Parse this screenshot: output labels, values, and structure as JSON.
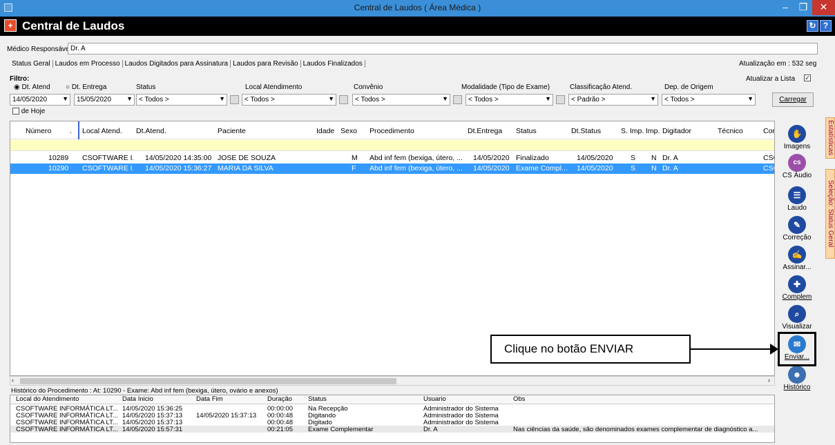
{
  "window": {
    "title": "Central de Laudos ( Área Médica )",
    "min": "–",
    "max": "❐",
    "close": "✕"
  },
  "app": {
    "title": "Central de Laudos",
    "logo": "+",
    "help": "?",
    "refresh": "↻"
  },
  "medico": {
    "label": "Médico Responsável:",
    "value": "Dr. A"
  },
  "tabs": [
    "Status Geral",
    "Laudos em Processo",
    "Laudos Digitados para Assinatura",
    "Laudos para Revisão",
    "Laudos Finalizados"
  ],
  "update_info": "Atualização em : 532 seg",
  "auto_update": {
    "label": "Atualizar a Lista",
    "checked": true
  },
  "filter": {
    "title": "Filtro:",
    "dt_atend": "Dt. Atend",
    "dt_entrega": "Dt. Entrega",
    "date_from": "14/05/2020",
    "date_to": "15/05/2020",
    "de_hoje": "de Hoje",
    "status_label": "Status",
    "status_value": "< Todos >",
    "local_label": "Local Atendimento",
    "local_value": "< Todos >",
    "convenio_label": "Convênio",
    "convenio_value": "< Todos >",
    "modalidade_label": "Modalidade (Tipo de Exame)",
    "modalidade_value": "< Todos >",
    "classif_label": "Classificação Atend.",
    "classif_value": "< Padrão >",
    "dep_label": "Dep. de Origem",
    "dep_value": "< Todos >",
    "carregar": "Carregar"
  },
  "grid": {
    "headers": [
      "Número",
      ".",
      "Local Atend.",
      "Dt.Atend.",
      "Paciente",
      "Idade",
      "Sexo",
      "Procedimento",
      "Dt.Entrega",
      "Status",
      "Dt.Status",
      "S. Imp.",
      "Imp.",
      "Digitador",
      "Técnico",
      "Cor"
    ],
    "rows": [
      [
        "10289",
        "CSOFTWARE I...",
        "14/05/2020 14:35:00",
        "JOSE DE SOUZA",
        "M",
        "Abd inf fem (bexiga, útero, ...",
        "14/05/2020",
        "Finalizado",
        "14/05/2020",
        "S",
        "N",
        "Dr. A",
        "CSC"
      ],
      [
        "10290",
        "CSOFTWARE I...",
        "14/05/2020 15:36:27",
        "MARIA DA SILVA",
        "F",
        "Abd inf fem (bexiga, útero, ...",
        "14/05/2020",
        "Exame Compl...",
        "14/05/2020",
        "S",
        "N",
        "Dr. A",
        "CSC"
      ]
    ]
  },
  "side_buttons": [
    {
      "label": "Imagens",
      "icon": "hand-icon",
      "color": "#1f4aa0"
    },
    {
      "label": "CS Áudio",
      "icon": "audio-icon",
      "color": "#9b4fa8"
    },
    {
      "label": "Laudo",
      "icon": "document-icon",
      "color": "#1f4aa0"
    },
    {
      "label": "Correção",
      "icon": "eraser-icon",
      "color": "#1f4aa0"
    },
    {
      "label": "Assinar...",
      "icon": "pen-icon",
      "color": "#1f4aa0"
    },
    {
      "label": "Complem",
      "icon": "complement-icon",
      "color": "#1f4aa0"
    },
    {
      "label": "Visualizar",
      "icon": "magnifier-icon",
      "color": "#1f4aa0"
    },
    {
      "label": "Enviar...",
      "icon": "envelope-icon",
      "color": "#2a7ad0"
    },
    {
      "label": "Histórico",
      "icon": "user-history-icon",
      "color": "#3b6fb0"
    }
  ],
  "vertical_tabs": [
    "Estatísticas",
    "Seleção: Status Geral"
  ],
  "history": {
    "caption": "Histórico do Procedimento : At: 10290 - Exame: Abd inf fem (bexiga, útero, ovário e anexos)",
    "headers": [
      "Local do Atendimento",
      "Data Inicio",
      "Data Fim",
      "Duração",
      "Status",
      "Usuario",
      "Obs"
    ],
    "rows": [
      [
        "CSOFTWARE INFORMÁTICA LT...",
        "14/05/2020 15:36:25",
        "",
        "00:00:00",
        "Na Recepção",
        "Administrador do Sistema",
        ""
      ],
      [
        "CSOFTWARE INFORMÁTICA LT...",
        "14/05/2020 15:37:13",
        "14/05/2020 15:37:13",
        "00:00:48",
        "Digitando",
        "Administrador do Sistema",
        ""
      ],
      [
        "CSOFTWARE INFORMÁTICA LT...",
        "14/05/2020 15:37:13",
        "",
        "00:00:48",
        "Digitado",
        "Administrador do Sistema",
        ""
      ],
      [
        "CSOFTWARE INFORMÁTICA LT...",
        "14/05/2020 15:57:31",
        "",
        "00:21:05",
        "Exame Complementar",
        "Dr. A",
        "Nas ciências da saúde, são denominados exames complementar de diagnóstico a..."
      ]
    ]
  },
  "callout": "Clique no botão ENVIAR"
}
